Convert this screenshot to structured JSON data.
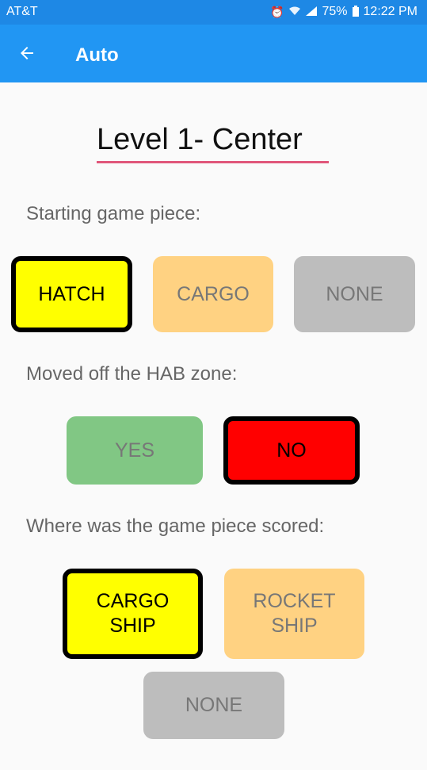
{
  "status_bar": {
    "carrier": "AT&T",
    "battery": "75%",
    "time": "12:22 PM"
  },
  "app_bar": {
    "title": "Auto"
  },
  "level": {
    "value": "Level 1- Center"
  },
  "starting_piece": {
    "label": "Starting game piece:",
    "options": [
      "HATCH",
      "CARGO",
      "NONE"
    ],
    "selected": "HATCH"
  },
  "hab_zone": {
    "label": "Moved off the HAB zone:",
    "options": [
      "YES",
      "NO"
    ],
    "selected": "NO"
  },
  "scored": {
    "label": "Where was the game piece scored:",
    "options": [
      "CARGO\nSHIP",
      "ROCKET\nSHIP",
      "NONE"
    ],
    "selected": "CARGO\nSHIP"
  },
  "colors": {
    "app_bar": "#2196f3",
    "status_bar": "#1e88e5",
    "accent_underline": "#e0567a",
    "yellow": "#ffff00",
    "orange": "#ffd282",
    "gray": "#bdbdbd",
    "green": "#81c784",
    "red": "#ff0000"
  }
}
